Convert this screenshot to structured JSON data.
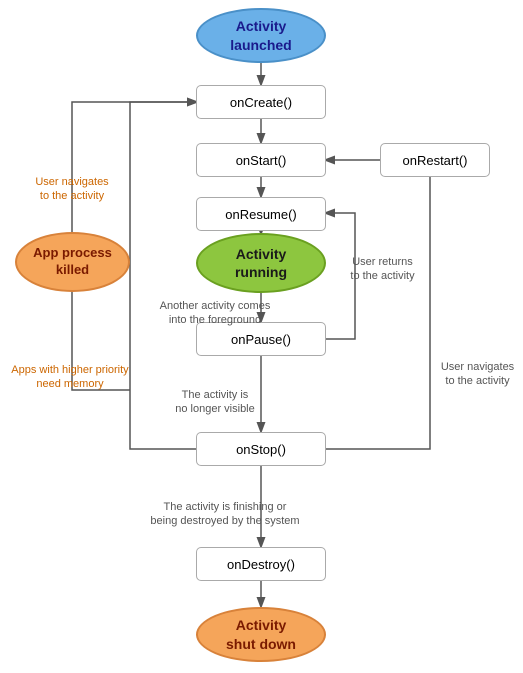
{
  "nodes": {
    "activity_launched": "Activity\nlaunched",
    "activity_running": "Activity\nrunning",
    "activity_shutdown": "Activity\nshut down",
    "app_process_killed": "App process\nkilled",
    "on_create": "onCreate()",
    "on_start": "onStart()",
    "on_resume": "onResume()",
    "on_pause": "onPause()",
    "on_stop": "onStop()",
    "on_destroy": "onDestroy()",
    "on_restart": "onRestart()"
  },
  "labels": {
    "user_navigates": "User navigates\nto the activity",
    "another_activity": "Another activity comes\ninto the foreground",
    "no_longer_visible": "The activity is\nno longer visible",
    "finishing": "The activity is finishing or\nbeing destroyed by the system",
    "user_returns": "User returns\nto the activity",
    "user_navigates2": "User navigates\nto the activity",
    "apps_higher_priority": "Apps with higher priority\nneed memory"
  }
}
